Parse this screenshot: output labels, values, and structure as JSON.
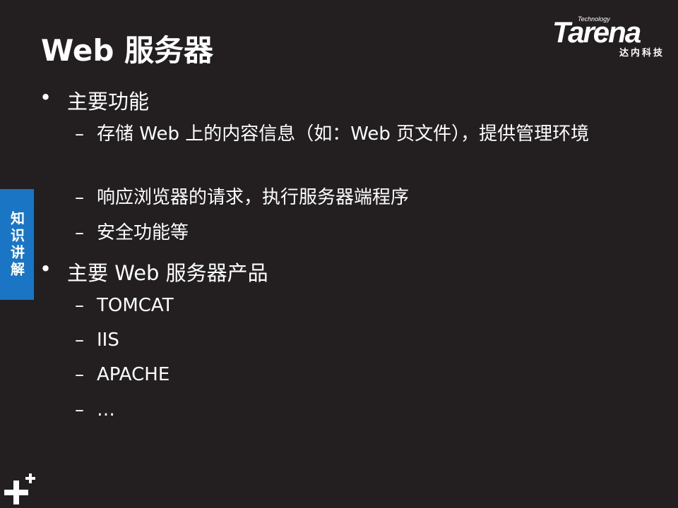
{
  "slide": {
    "title": "Web 服务器"
  },
  "logo": {
    "tagline": "Technology",
    "wordmark": "Tarena",
    "chinese_name": "达内科技"
  },
  "side_tab": {
    "label": "知识讲解"
  },
  "bullets": [
    {
      "bullet": "•",
      "text": "主要功能",
      "sub": [
        {
          "dash": "–",
          "text": "存储 Web 上的内容信息（如：Web 页文件），提供管理环境"
        },
        {
          "dash": "–",
          "text": "响应浏览器的请求，执行服务器端程序"
        },
        {
          "dash": "–",
          "text": "安全功能等"
        }
      ]
    },
    {
      "bullet": "•",
      "text": "主要 Web 服务器产品",
      "sub": [
        {
          "dash": "–",
          "text": "TOMCAT"
        },
        {
          "dash": "–",
          "text": "IIS"
        },
        {
          "dash": "–",
          "text": "APACHE"
        },
        {
          "dash": "–",
          "text": "…"
        }
      ]
    }
  ],
  "colors": {
    "background": "#231f20",
    "text": "#ffffff",
    "side_tab": "#1a75c4"
  },
  "icons": {
    "corner_mark": "plus-plus-icon"
  }
}
